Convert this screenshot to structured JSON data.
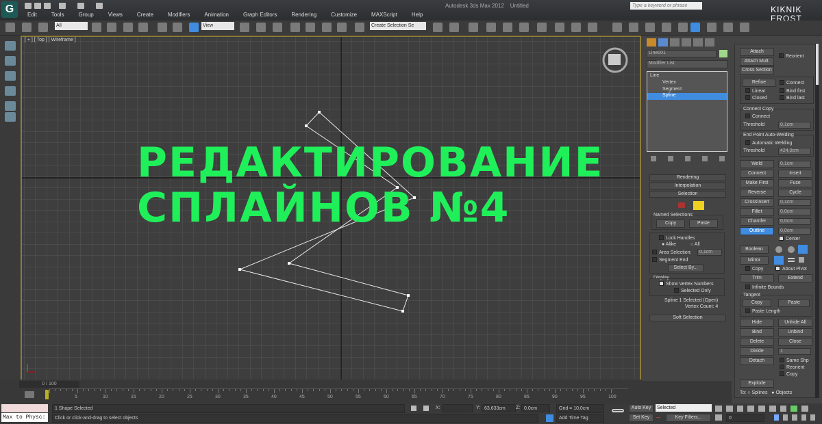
{
  "app": {
    "title": "Autodesk 3ds Max  2012",
    "document": "Untitled",
    "logo": "3ds Max",
    "search_placeholder": "Type a keyword or phrase",
    "brand": [
      "KIKNIK",
      "FROST"
    ]
  },
  "menu": [
    "Edit",
    "Tools",
    "Group",
    "Views",
    "Create",
    "Modifiers",
    "Animation",
    "Graph Editors",
    "Rendering",
    "Customize",
    "MAXScript",
    "Help"
  ],
  "toolbar": {
    "filter": "All",
    "ref_coord": "View",
    "named_sel": "Create Selection Se"
  },
  "viewport": {
    "label": "[ + ] [ Top ] [ Wireframe ]",
    "overlay": [
      "РЕДАКТИРОВАНИЕ",
      "СПЛАЙНОВ №4"
    ]
  },
  "command_panel": {
    "object_name": "Line001",
    "object_color": "#9fd88a",
    "modifier_list": "Modifier List",
    "stack": [
      "Line",
      "Vertex",
      "Segment",
      "Spline"
    ],
    "rollouts": {
      "rendering": "Rendering",
      "interpolation": "Interpolation",
      "selection": "Selection",
      "soft_selection": "Soft Selection"
    },
    "selection": {
      "named_selections": "Named Selections:",
      "copy": "Copy",
      "paste": "Paste",
      "lock_handles": "Lock Handles",
      "alike": "Alike",
      "all": "All",
      "area_selection": "Area Selection:",
      "area_value": "0,1cm",
      "segment_end": "Segment End",
      "select_by": "Select By...",
      "display": "Display",
      "show_vertex_numbers": "Show Vertex Numbers",
      "selected_only": "Selected Only",
      "info1": "Spline 1 Selected (Open)",
      "info2": "Vertex Count: 4"
    },
    "geometry": {
      "attach": "Attach",
      "attach_mult": "Attach Mult.",
      "cross_section": "Cross Section",
      "reorient": "Reorient",
      "refine": "Refine",
      "connect": "Connect",
      "linear": "Linear",
      "bind_first": "Bind first",
      "closed": "Closed",
      "bind_last": "Bind last",
      "connect_copy": "Connect Copy",
      "connect2": "Connect",
      "threshold": "Threshold",
      "threshold_value": "0,1cm",
      "end_point": "End Point Auto-Welding",
      "auto_weld": "Automatic Welding",
      "threshold2": "Threshold",
      "threshold2_value": "424,0cm",
      "weld": "Weld",
      "weld_value": "0,1cm",
      "connect3": "Connect",
      "insert": "Insert",
      "make_first": "Make First",
      "fuse": "Fuse",
      "reverse": "Reverse",
      "cycle": "Cycle",
      "crossinsert": "CrossInsert",
      "crossinsert_value": "0,1cm",
      "fillet": "Fillet",
      "fillet_value": "0,0cm",
      "chamfer": "Chamfer",
      "chamfer_value": "0,0cm",
      "outline": "Outline",
      "outline_value": "0,0cm",
      "center": "Center",
      "boolean": "Boolean",
      "mirror": "Mirror",
      "copy": "Copy",
      "about_pivot": "About Pivot",
      "trim": "Trim",
      "extend": "Extend",
      "infinite_bounds": "Infinite Bounds",
      "tangent": "Tangent",
      "t_copy": "Copy",
      "t_paste": "Paste",
      "paste_length": "Paste Length",
      "hide": "Hide",
      "unhide_all": "Unhide All",
      "bind": "Bind",
      "unbind": "Unbind",
      "delete": "Delete",
      "close": "Close",
      "divide": "Divide",
      "divide_value": "1",
      "detach": "Detach",
      "same_shp": "Same Shp",
      "reorient2": "Reorient",
      "copy2": "Copy",
      "explode": "Explode",
      "to": "To:",
      "splines": "Splines",
      "objects": "Objects"
    }
  },
  "timeline": {
    "frame": "0 / 100",
    "ticks": [
      "5",
      "10",
      "15",
      "20",
      "25",
      "30",
      "35",
      "40",
      "45",
      "50",
      "55",
      "60",
      "65",
      "70",
      "75",
      "80",
      "85",
      "90",
      "95",
      "100"
    ]
  },
  "status": {
    "maxscript": "Max to Physc:",
    "selected": "1 Shape Selected",
    "prompt": "Click or click-and-drag to select objects",
    "x_label": "X:",
    "y_label": "Y:",
    "y_value": "63,633cm",
    "z_label": "Z:",
    "z_value": "0,0cm",
    "grid": "Grid = 10,0cm",
    "add_time_tag": "Add Time Tag",
    "auto_key": "Auto Key",
    "set_key": "Set Key",
    "key_mode": "Selected",
    "key_filters": "Key Filters...",
    "frame": "0"
  }
}
